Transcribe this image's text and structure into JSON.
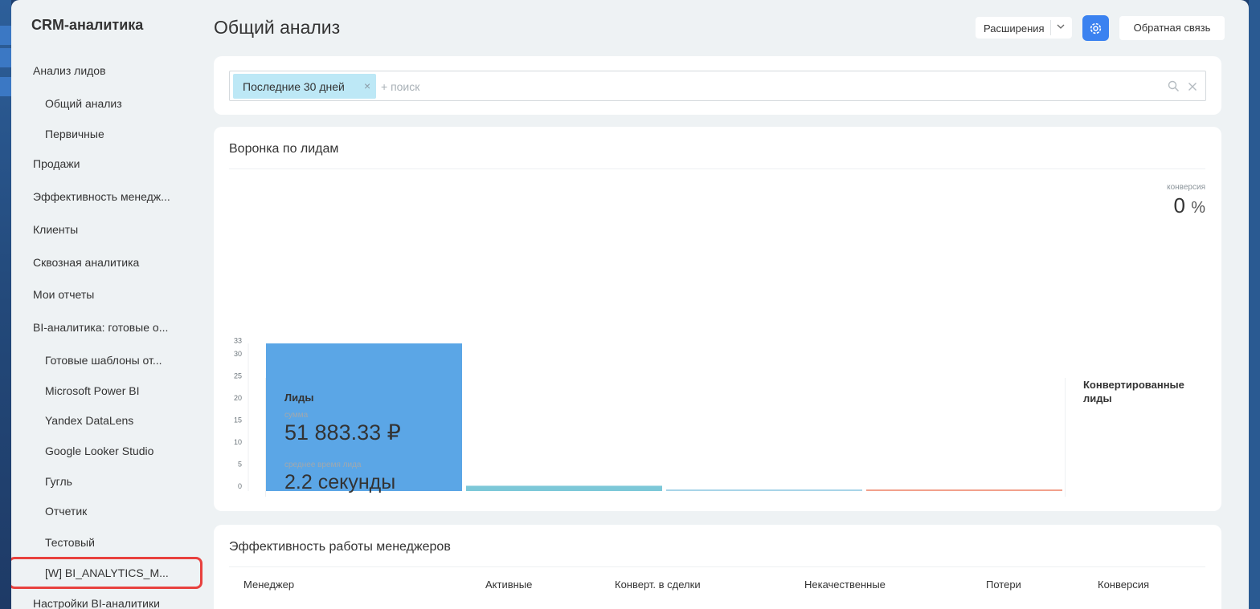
{
  "sidebar": {
    "title": "CRM-аналитика",
    "items": [
      {
        "label": "Анализ лидов",
        "level": 1
      },
      {
        "label": "Общий анализ",
        "level": 2
      },
      {
        "label": "Первичные",
        "level": 2
      },
      {
        "label": "Продажи",
        "level": 1
      },
      {
        "label": "Эффективность менедж...",
        "level": 1
      },
      {
        "label": "Клиенты",
        "level": 1
      },
      {
        "label": "Сквозная аналитика",
        "level": 1
      },
      {
        "label": "Мои отчеты",
        "level": 1
      },
      {
        "label": "BI-аналитика: готовые о...",
        "level": 1
      },
      {
        "label": "Готовые шаблоны от...",
        "level": 2
      },
      {
        "label": "Microsoft Power BI",
        "level": 2
      },
      {
        "label": "Yandex DataLens",
        "level": 2
      },
      {
        "label": "Google Looker Studio",
        "level": 2
      },
      {
        "label": "Гугль",
        "level": 2
      },
      {
        "label": "Отчетик",
        "level": 2
      },
      {
        "label": "Тестовый",
        "level": 2
      },
      {
        "label": "[W] BI_ANALYTICS_M...",
        "level": 2,
        "highlighted": true
      },
      {
        "label": "Настройки BI-аналитики",
        "level": 1
      }
    ]
  },
  "header": {
    "title": "Общий анализ",
    "extensions_label": "Расширения",
    "settings_icon": "gear-icon",
    "feedback_label": "Обратная связь"
  },
  "filter": {
    "chip_label": "Последние 30 дней",
    "search_placeholder": "+ поиск"
  },
  "funnel": {
    "title": "Воронка по лидам",
    "conversion_label": "конверсия",
    "conversion_value": "0",
    "conversion_unit": "%",
    "leads_title": "Лиды",
    "sum_label": "сумма",
    "sum_value": "51 883.33 ₽",
    "avg_time_label": "среднее время лида",
    "avg_time_value": "2.2 секунды",
    "converted_title": "Конвертированные лиды"
  },
  "chart_data": {
    "type": "bar",
    "categories": [
      "",
      "",
      "",
      ""
    ],
    "values": [
      33.5,
      1.2,
      0.3,
      0.3
    ],
    "colors": [
      "#5ba6e6",
      "#7cc8d8",
      "#a8d4e8",
      "#f2a08c"
    ],
    "yticks": [
      0,
      5,
      10,
      15,
      20,
      25,
      30,
      33
    ],
    "ylim": [
      0,
      33.5
    ],
    "title": "",
    "xlabel": "",
    "ylabel": "",
    "grid": false
  },
  "managers": {
    "title": "Эффективность работы менеджеров",
    "columns": [
      "Менеджер",
      "Активные",
      "Конверт. в сделки",
      "Некачественные",
      "Потери",
      "Конверсия"
    ]
  },
  "colors": {
    "accent": "#3b82f0",
    "highlight_border": "#e8413e",
    "chip_bg": "#bde8f6",
    "bar_primary": "#5ba6e6"
  }
}
